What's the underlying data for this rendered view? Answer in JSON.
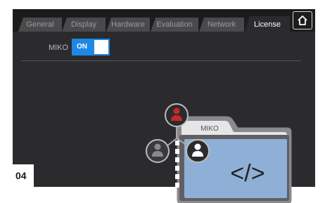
{
  "tabs": [
    {
      "label": "General",
      "active": false
    },
    {
      "label": "Display",
      "active": false
    },
    {
      "label": "Hardware",
      "active": false
    },
    {
      "label": "Evaluation",
      "active": false
    },
    {
      "label": "Network",
      "active": false
    },
    {
      "label": "License",
      "active": true
    }
  ],
  "home_icon": "home-icon",
  "setting": {
    "label": "MIKO",
    "toggle_state": "ON"
  },
  "illustration": {
    "folder_label": "MIKO",
    "code_symbol": "</>"
  },
  "figure_tag": "04",
  "colors": {
    "accent": "#1e88e5",
    "background": "#2b2b2d",
    "user_active": "#c62828",
    "folder": "#8fb0d6"
  }
}
